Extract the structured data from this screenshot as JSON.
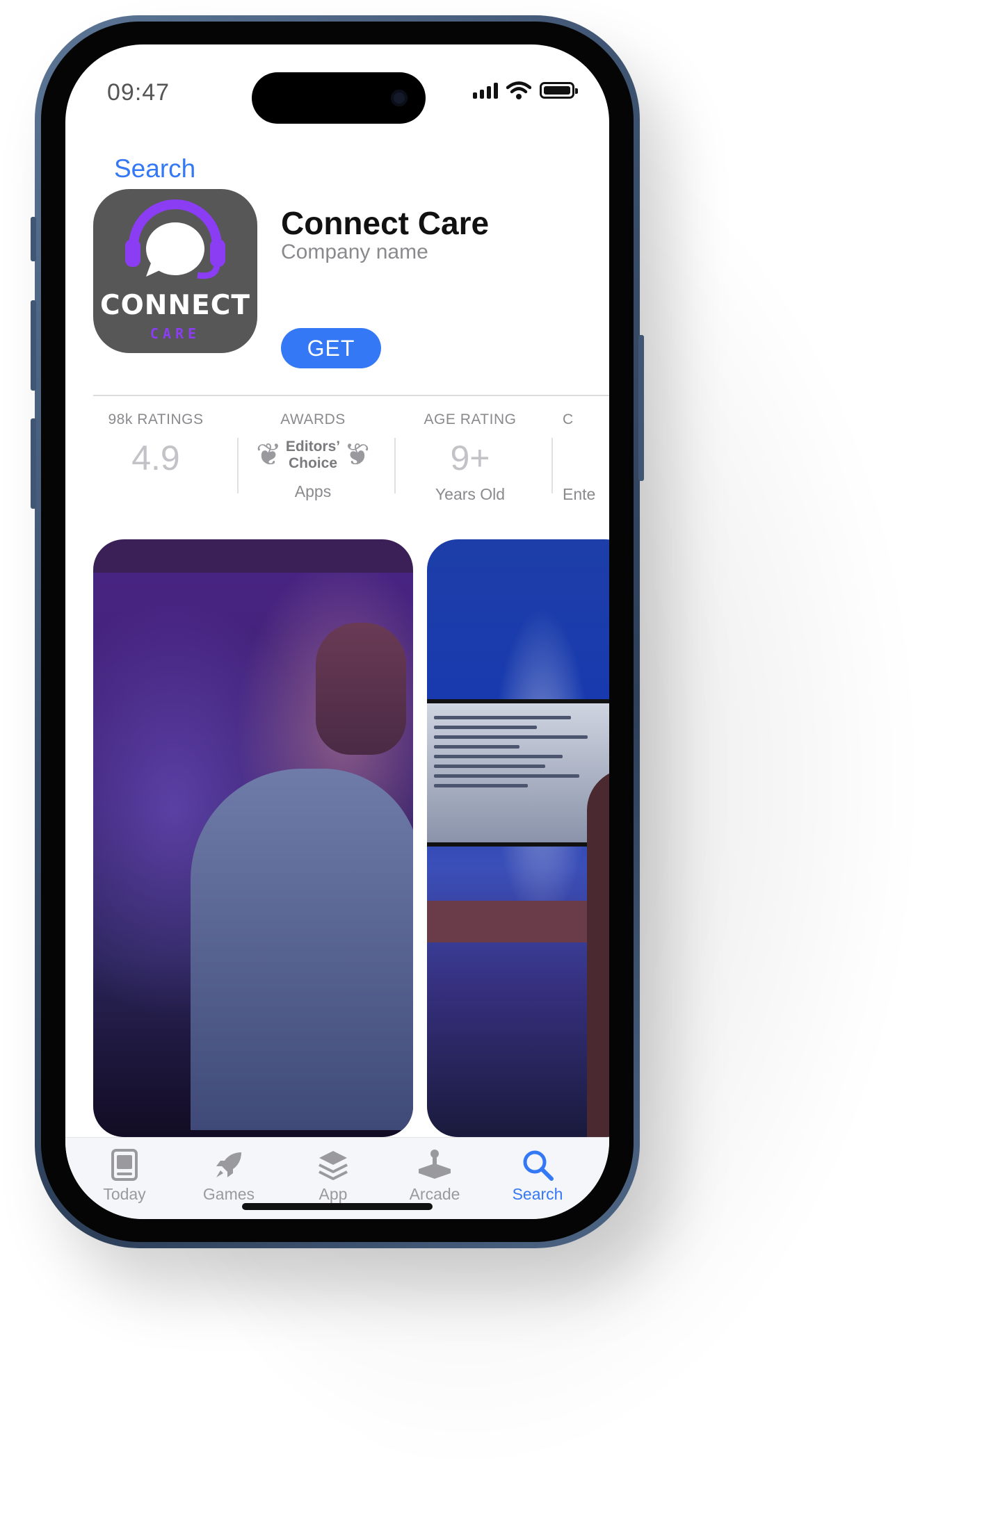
{
  "status_bar": {
    "time": "09:47"
  },
  "nav": {
    "back_label": "Search"
  },
  "app": {
    "name": "Connect Care",
    "company": "Company name",
    "get_label": "GET",
    "icon_word": "CONNECT",
    "icon_sub": "CARE"
  },
  "stats": [
    {
      "label": "98k RATINGS",
      "value": "4.9"
    },
    {
      "label": "AWARDS",
      "award_line1": "Editors’",
      "award_line2": "Choice",
      "sub": "Apps"
    },
    {
      "label": "AGE RATING",
      "value": "9+",
      "sub": "Years Old"
    },
    {
      "label": "C",
      "sub": "Ente"
    }
  ],
  "tabs": [
    {
      "label": "Today",
      "icon": "today-icon"
    },
    {
      "label": "Games",
      "icon": "rocket-icon"
    },
    {
      "label": "App",
      "icon": "layers-icon"
    },
    {
      "label": "Arcade",
      "icon": "joystick-icon"
    },
    {
      "label": "Search",
      "icon": "search-icon",
      "active": true
    }
  ],
  "colors": {
    "accent": "#3478f6",
    "brand_purple": "#8a3df2",
    "icon_bg": "#575757",
    "frame": "#3a4f6c"
  }
}
